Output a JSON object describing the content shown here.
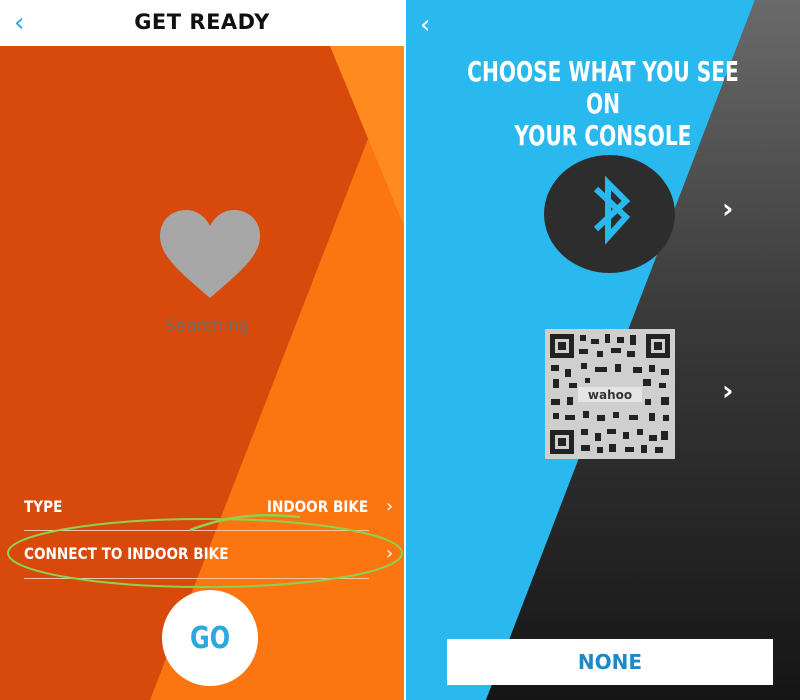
{
  "left_screen": {
    "header": {
      "back_icon": "‹",
      "title": "GET READY"
    },
    "status": {
      "icon": "heart-icon",
      "text": "Searching"
    },
    "type_row": {
      "label": "TYPE",
      "value": "INDOOR BIKE",
      "chevron": "›"
    },
    "connect_row": {
      "label": "CONNECT TO INDOOR BIKE",
      "chevron": "›"
    },
    "go_button": {
      "label": "GO"
    },
    "colors": {
      "bg_dark": "#d84a0b",
      "bg_light": "#ff7a12",
      "accent": "#2aa8e0"
    }
  },
  "right_screen": {
    "back_icon": "‹",
    "title_line1": "CHOOSE WHAT YOU SEE ON",
    "title_line2": "YOUR CONSOLE",
    "options": [
      {
        "icon": "bluetooth-icon",
        "chevron": "›"
      },
      {
        "icon": "qr-code-icon",
        "qr_text": "wahoo",
        "chevron": "›"
      }
    ],
    "none_button": {
      "label": "NONE"
    },
    "colors": {
      "bg_blue": "#29b9ef",
      "bg_dark": "#1f1f1f",
      "accent": "#1e88c8"
    }
  }
}
